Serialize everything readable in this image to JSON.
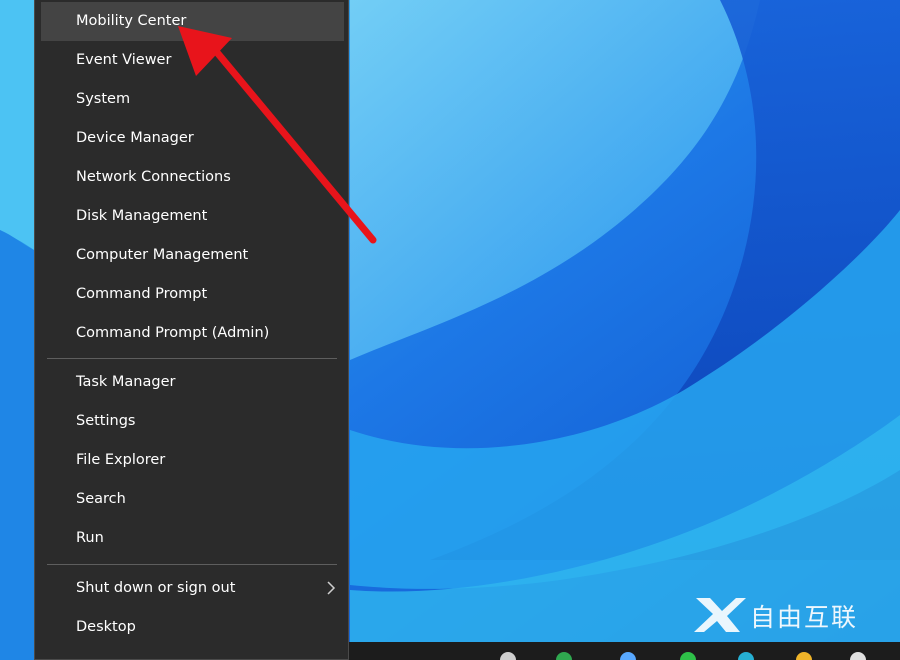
{
  "menu": {
    "group1": [
      {
        "label": "Mobility Center",
        "name": "menu-item-mobility-center"
      },
      {
        "label": "Event Viewer",
        "name": "menu-item-event-viewer"
      },
      {
        "label": "System",
        "name": "menu-item-system"
      },
      {
        "label": "Device Manager",
        "name": "menu-item-device-manager"
      },
      {
        "label": "Network Connections",
        "name": "menu-item-network-connections"
      },
      {
        "label": "Disk Management",
        "name": "menu-item-disk-management"
      },
      {
        "label": "Computer Management",
        "name": "menu-item-computer-management"
      },
      {
        "label": "Command Prompt",
        "name": "menu-item-command-prompt"
      },
      {
        "label": "Command Prompt (Admin)",
        "name": "menu-item-command-prompt-admin"
      }
    ],
    "group2": [
      {
        "label": "Task Manager",
        "name": "menu-item-task-manager"
      },
      {
        "label": "Settings",
        "name": "menu-item-settings"
      },
      {
        "label": "File Explorer",
        "name": "menu-item-file-explorer"
      },
      {
        "label": "Search",
        "name": "menu-item-search"
      },
      {
        "label": "Run",
        "name": "menu-item-run"
      }
    ],
    "group3": [
      {
        "label": "Shut down or sign out",
        "name": "menu-item-shut-down",
        "submenu": true
      },
      {
        "label": "Desktop",
        "name": "menu-item-desktop"
      }
    ],
    "highlighted": "Mobility Center"
  },
  "annotation": {
    "icon": "red-arrow-icon",
    "color": "#e8141b"
  },
  "watermark": {
    "text": "自由互联",
    "icon": "x-logo-icon"
  },
  "colors": {
    "menu_bg": "#2b2b2b",
    "hover_bg": "#444444",
    "desktop_blue": "#1a6fe0",
    "taskbar": "#1c1c1c"
  }
}
